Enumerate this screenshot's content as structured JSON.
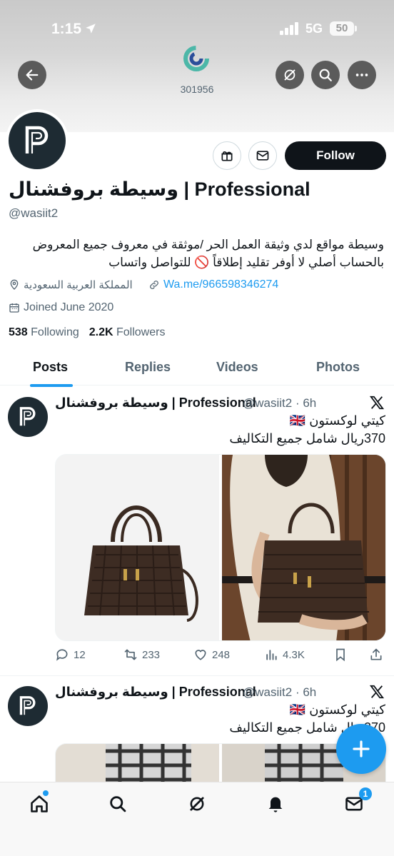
{
  "status_bar": {
    "time": "1:15",
    "network": "5G",
    "battery": "50"
  },
  "header": {
    "post_count": "301956"
  },
  "profile": {
    "display_name": "وسيطة بروفشنال | Professional",
    "handle": "@wasiit2",
    "follow_label": "Follow",
    "bio_line1": "وسيطة مواقع لدي وثيقة العمل الحر /موثقة في معروف جميع المعروض",
    "bio_line2": "بالحساب أصلي لا أوفر تقليد إطلاقاً 🚫 للتواصل واتساب",
    "location": "المملكة العربية السعودية",
    "link": "Wa.me/966598346274",
    "joined": "Joined June 2020",
    "following_count": "538",
    "following_label": "Following",
    "followers_count": "2.2K",
    "followers_label": "Followers"
  },
  "tabs": [
    {
      "label": "Posts",
      "active": true
    },
    {
      "label": "Replies",
      "active": false
    },
    {
      "label": "Videos",
      "active": false
    },
    {
      "label": "Photos",
      "active": false
    }
  ],
  "posts": [
    {
      "name": "وسيطة بروفشنال | Professional",
      "handle_time": "@wasiit2 · 6h",
      "line1": "كيتي لوكستون 🇬🇧",
      "line2": "370ريال شامل جميع التكاليف",
      "replies": "12",
      "reposts": "233",
      "likes": "248",
      "views": "4.3K"
    },
    {
      "name": "وسيطة بروفشنال | Professional",
      "handle_time": "@wasiit2 · 6h",
      "line1": "كيتي لوكستون 🇬🇧",
      "line2": "370ريال شامل جميع التكاليف"
    }
  ],
  "bottom_nav": {
    "messages_badge": "1"
  }
}
